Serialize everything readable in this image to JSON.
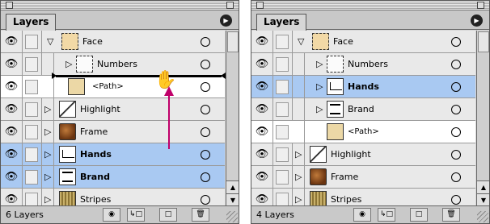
{
  "accent_selection_color": "#a9c9f2",
  "panels": [
    {
      "tab_label": "Layers",
      "menu_icon": "flyout-arrow-icon",
      "status": "6 Layers",
      "rows": [
        {
          "label": "Face",
          "thumb": "face"
        },
        {
          "label": "Numbers",
          "thumb": "numbers"
        },
        {
          "label": "<Path>",
          "thumb": "path"
        },
        {
          "label": "Highlight",
          "thumb": "highlight"
        },
        {
          "label": "Frame",
          "thumb": "frame"
        },
        {
          "label": "Hands",
          "thumb": "hands"
        },
        {
          "label": "Brand",
          "thumb": "brand"
        },
        {
          "label": "Stripes",
          "thumb": "stripes"
        }
      ]
    },
    {
      "tab_label": "Layers",
      "menu_icon": "flyout-arrow-icon",
      "status": "4 Layers",
      "rows": [
        {
          "label": "Face",
          "thumb": "face"
        },
        {
          "label": "Numbers",
          "thumb": "numbers"
        },
        {
          "label": "Hands",
          "thumb": "hands"
        },
        {
          "label": "Brand",
          "thumb": "brand"
        },
        {
          "label": "<Path>",
          "thumb": "path"
        },
        {
          "label": "Highlight",
          "thumb": "highlight"
        },
        {
          "label": "Frame",
          "thumb": "frame"
        },
        {
          "label": "Stripes",
          "thumb": "stripes"
        }
      ]
    }
  ],
  "status_buttons": [
    "make-clipping-mask-icon",
    "new-sublayer-icon",
    "new-layer-icon",
    "trash-icon"
  ],
  "drag_indicator": {
    "icon": "grab-hand-icon",
    "direction": "up"
  }
}
